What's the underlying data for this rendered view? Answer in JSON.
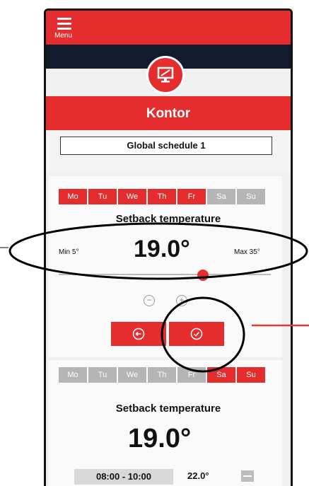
{
  "app": {
    "menu_label": "Menu",
    "room_name": "Kontor"
  },
  "schedule": {
    "name": "Global schedule 1"
  },
  "panel_weekday": {
    "days": [
      {
        "label": "Mo",
        "active": true
      },
      {
        "label": "Tu",
        "active": true
      },
      {
        "label": "We",
        "active": true
      },
      {
        "label": "Th",
        "active": true
      },
      {
        "label": "Fr",
        "active": true
      },
      {
        "label": "Sa",
        "active": false
      },
      {
        "label": "Su",
        "active": false
      }
    ],
    "title": "Setback temperature",
    "min_label": "Min 5°",
    "max_label": "Max 35°",
    "temperature": "19.0°",
    "slider_value": 19.0,
    "slider_min": 5,
    "slider_max": 35,
    "decrement_symbol": "−",
    "increment_symbol": "+"
  },
  "panel_weekend": {
    "days": [
      {
        "label": "Mo",
        "active": false
      },
      {
        "label": "Tu",
        "active": false
      },
      {
        "label": "We",
        "active": false
      },
      {
        "label": "Th",
        "active": false
      },
      {
        "label": "Fr",
        "active": false
      },
      {
        "label": "Sa",
        "active": true
      },
      {
        "label": "Su",
        "active": true
      }
    ],
    "title": "Setback temperature",
    "temperature": "19.0°",
    "periods": [
      {
        "time": "08:00 - 10:00",
        "temp": "22.0°"
      }
    ]
  },
  "colors": {
    "accent": "#e62d2d",
    "dark_band": "#141a2e",
    "inactive": "#b5b5b5"
  },
  "icons": [
    "hamburger-icon",
    "monitor-icon",
    "undo-icon",
    "check-icon",
    "minus-icon",
    "plus-icon"
  ]
}
